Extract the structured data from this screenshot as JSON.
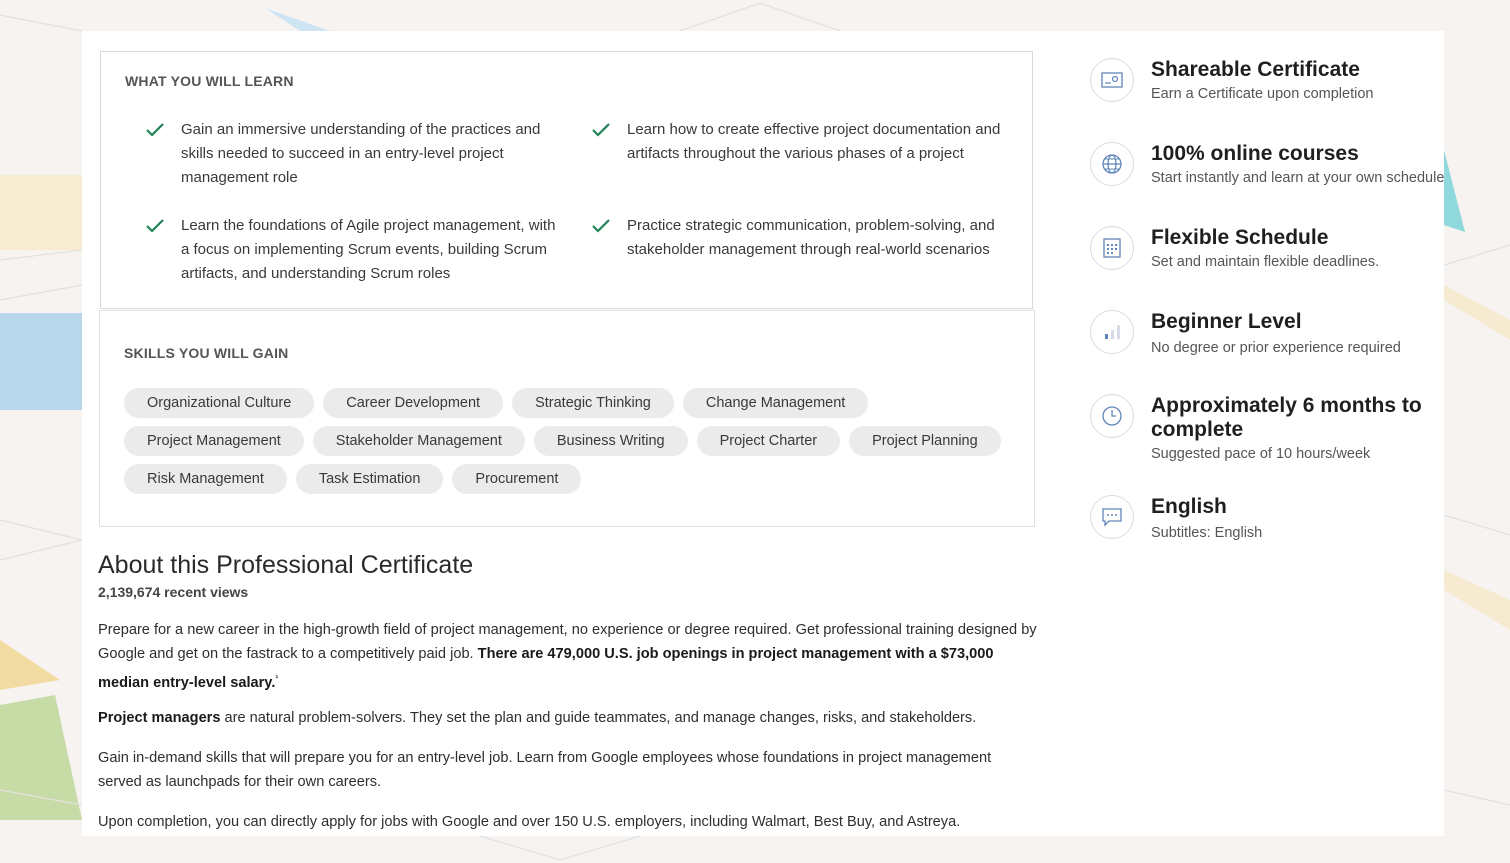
{
  "learn": {
    "heading": "WHAT YOU WILL LEARN",
    "items": [
      "Gain an immersive understanding of the practices and skills needed to succeed in an entry-level project management role",
      "Learn how to create effective project documentation and artifacts throughout the various phases of a project",
      "Learn the foundations of Agile project management, with a focus on implementing Scrum events, building Scrum artifacts, and understanding Scrum roles",
      "Practice strategic communication, problem-solving, and stakeholder management through real-world scenarios"
    ]
  },
  "skills": {
    "heading": "SKILLS YOU WILL GAIN",
    "rows": [
      [
        "Organizational Culture",
        "Career Development",
        "Strategic Thinking",
        "Change Management"
      ],
      [
        "Project Management",
        "Stakeholder Management",
        "Business Writing",
        "Project Charter",
        "Project Planning"
      ],
      [
        "Risk Management",
        "Task Estimation",
        "Procurement"
      ]
    ]
  },
  "about": {
    "title": "About this Professional Certificate",
    "views": "2,139,674 recent views",
    "p1_a": "Prepare for a new career in the high-growth field of project management, no experience or degree required. Get professional training designed by Google and get on the fastrack to a competitively paid job. ",
    "p1_b": "There are 479,000 U.S. job openings in project management with a $73,000 median entry-level salary.",
    "p1_sup": "¹",
    "p2_b": "Project managers",
    "p2_a": " are natural problem-solvers. They set the plan and guide teammates, and manage changes, risks, and stakeholders.",
    "p3": "Gain in-demand skills that will prepare you for an entry-level job. Learn from Google employees whose foundations in project management served as launchpads for their own careers.",
    "p4": "Upon completion, you can directly apply for jobs with Google and over 150 U.S. employers, including Walmart, Best Buy, and Astreya."
  },
  "features": [
    {
      "icon": "certificate-icon",
      "title": "Shareable Certificate",
      "subtitle": "Earn a Certificate upon completion"
    },
    {
      "icon": "globe-icon",
      "title": "100% online courses",
      "subtitle": "Start instantly and learn at your own schedule."
    },
    {
      "icon": "calendar-icon",
      "title": "Flexible Schedule",
      "subtitle": "Set and maintain flexible deadlines."
    },
    {
      "icon": "level-bars-icon",
      "title": "Beginner Level",
      "subtitle": "No degree or prior experience required"
    },
    {
      "icon": "clock-icon",
      "title": "Approximately 6 months to complete",
      "subtitle": "Suggested pace of 10 hours/week"
    },
    {
      "icon": "chat-bubble-icon",
      "title": "English",
      "subtitle": "Subtitles: English"
    }
  ],
  "colors": {
    "check": "#1f8354",
    "icon": "#5f86b8",
    "chip_bg": "#ebebeb"
  }
}
